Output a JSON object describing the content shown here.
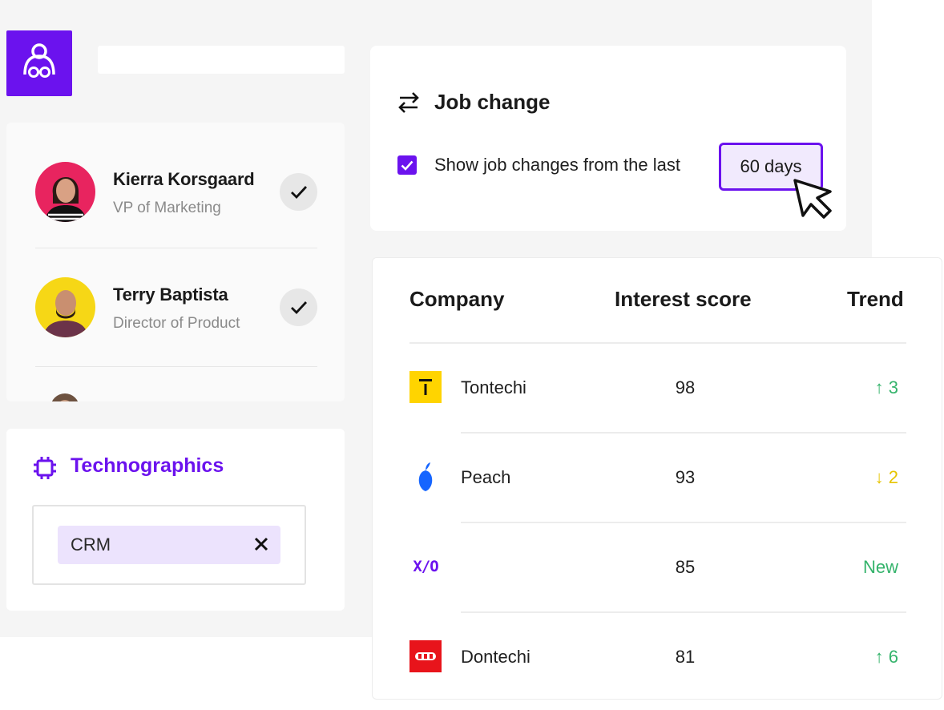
{
  "people": [
    {
      "name": "Kierra Korsgaard",
      "title": "VP of Marketing",
      "avatar_bg": "#e8245f"
    },
    {
      "name": "Terry Baptista",
      "title": "Director of Product",
      "avatar_bg": "#f6d716"
    }
  ],
  "technographics": {
    "title": "Technographics",
    "tags": [
      {
        "label": "CRM"
      }
    ]
  },
  "job_change": {
    "title": "Job change",
    "checkbox_label": "Show job changes from the last",
    "checked": true,
    "days_value": "60 days"
  },
  "table": {
    "headers": {
      "company": "Company",
      "score": "Interest score",
      "trend": "Trend"
    },
    "rows": [
      {
        "company": "Tontechi",
        "logo": "tontechi-logo",
        "score": "98",
        "trend": "↑ 3",
        "trend_color": "#34b36b"
      },
      {
        "company": "Peach",
        "logo": "peach-logo",
        "score": "93",
        "trend": "↓ 2",
        "trend_color": "#e6c400"
      },
      {
        "company": "",
        "logo": "xo-logo",
        "logo_text": "X/O",
        "score": "85",
        "trend": "New",
        "trend_color": "#34b36b"
      },
      {
        "company": "Dontechi",
        "logo": "dontechi-logo",
        "score": "81",
        "trend": "↑ 6",
        "trend_color": "#34b36b"
      }
    ]
  },
  "colors": {
    "accent": "#6b12ee",
    "accent_light": "#ece3fd",
    "up": "#34b36b",
    "down": "#e6c400"
  }
}
